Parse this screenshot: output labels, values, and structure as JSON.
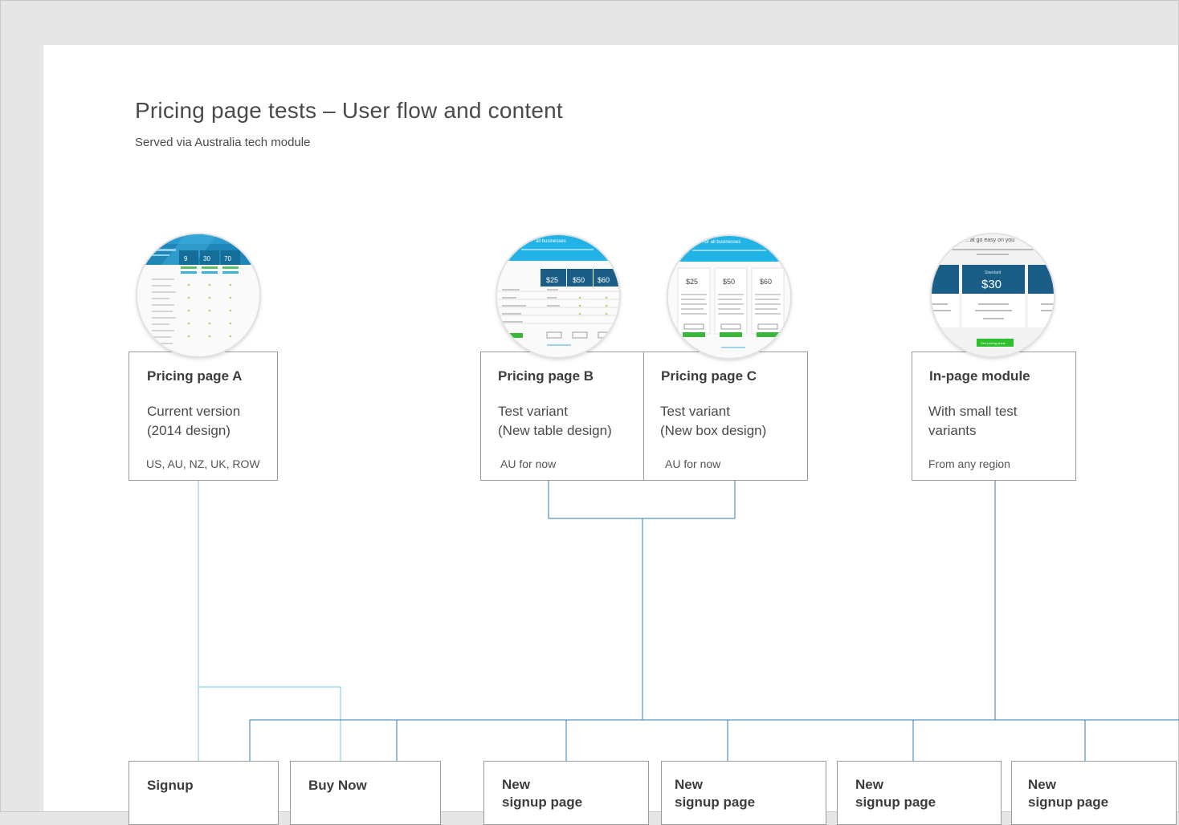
{
  "page": {
    "title": "Pricing page tests – User flow and content",
    "subtitle": "Served via Australia tech module"
  },
  "colors": {
    "connector_light": "#7ec3e3",
    "connector_dark": "#2f7bb0",
    "box_border": "#9a9a9a",
    "accent": "#1aa9e0",
    "cta_green": "#3ab73a"
  },
  "pages": [
    {
      "title": "Pricing page A",
      "desc_line1": "Current version",
      "desc_line2": "(2014 design)",
      "region": "US, AU, NZ, UK, ROW"
    },
    {
      "title": "Pricing page B",
      "desc_line1": "Test variant",
      "desc_line2": "(New table design)",
      "region": "AU for now"
    },
    {
      "title": "Pricing page C",
      "desc_line1": "Test variant",
      "desc_line2": "(New box design)",
      "region": "AU for now"
    },
    {
      "title": "In-page module",
      "desc_line1": "With small test",
      "desc_line2": "variants",
      "region": "From any region"
    }
  ],
  "thumbnails": {
    "a": {
      "prices": [
        "9",
        "30",
        "70"
      ],
      "icon": "pricing-table-screenshot"
    },
    "b": {
      "header": "all businesses",
      "prices": [
        "$25",
        "$50",
        "$60"
      ],
      "icon": "pricing-table-screenshot"
    },
    "c": {
      "header": "for all businesses",
      "prices": [
        "$25",
        "$50",
        "$60"
      ],
      "icon": "pricing-boxes-screenshot"
    },
    "d": {
      "header": "...at go easy on you",
      "plan": "Standard",
      "price": "$30",
      "cta": "See pricing plans",
      "icon": "pricing-module-screenshot"
    }
  },
  "targets": [
    {
      "label": "Signup"
    },
    {
      "label": "Buy Now"
    },
    {
      "label": "New\nsignup page"
    },
    {
      "label": "New\nsignup page"
    },
    {
      "label": "New\nsignup page"
    },
    {
      "label": "New\nsignup page"
    }
  ]
}
